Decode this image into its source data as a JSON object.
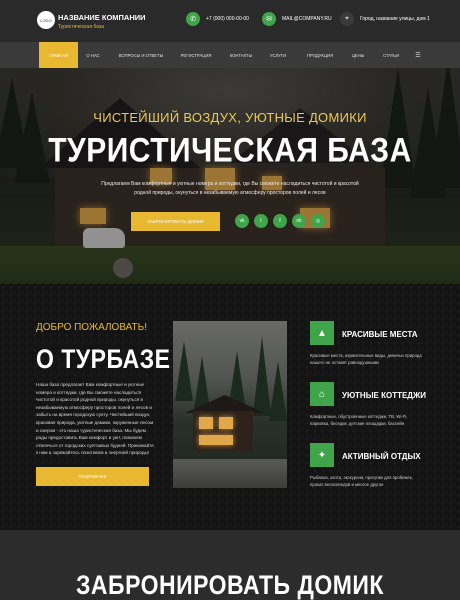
{
  "header": {
    "logo_text": "LOGO",
    "company_name": "НАЗВАНИЕ КОМПАНИИ",
    "company_sub": "Туристическая база",
    "phone": "+7 (000) 000-00-00",
    "email": "MAIL@COMPANY.RU",
    "address": "Город, название улицы, дом 1",
    "phone_icon": "phone-icon",
    "mail_icon": "mail-icon",
    "location_icon": "location-pin-icon"
  },
  "nav": {
    "items": [
      "ГЛАВНАЯ",
      "О НАС",
      "ВОПРОСЫ И ОТВЕТЫ",
      "РЕГИСТРАЦИЯ",
      "КОНТАКТЫ",
      "УСЛУГИ",
      "ПРОДУКЦИЯ",
      "ЦЕНЫ",
      "СТАТЬИ",
      "☰"
    ],
    "active": "ГЛАВНАЯ"
  },
  "hero": {
    "tagline": "ЧИСТЕЙШИЙ ВОЗДУХ, УЮТНЫЕ ДОМИКИ",
    "title": "ТУРИСТИЧЕСКАЯ БАЗА",
    "description": "Предлагаем Вам комфортные и уютные номера и коттеджи, где Вы сможете насладиться чистотой и красотой родной природы, окунуться в незабываемую атмосферу просторов полей и лесов",
    "button": "ЗАБРОНИРОВАТЬ ДОМИК",
    "social": [
      "vk-icon",
      "twitter-icon",
      "facebook-icon",
      "odnoklassniki-icon",
      "instagram-icon"
    ]
  },
  "about": {
    "welcome": "ДОБРО ПОЖАЛОВАТЬ!",
    "title": "О ТУРБАЗЕ",
    "text": "Наша база предлагает Вам комфортные и уютные номера и коттеджи, где Вы сможете насладиться чистотой и красотой родной природы, окунуться в незабываемую атмосферу просторов полей и лесов и забыть на время городскую суету. Чистейший воздух, красивая природа, уютные домики, окруженные лесом и озером - это наша туристическая база. Мы будем рады предоставить Вам комфорт и уют, поможем отвлечься от городских суетливых будней. Приезжайте к нам и заряжайтесь позитивом и энергией природы!",
    "button": "ПОДРОБНЕЕ"
  },
  "features": [
    {
      "icon": "mountains-icon",
      "title": "КРАСИВЫЕ МЕСТА",
      "desc": "Красивые места, изумительные виды, девичьи природа нашего не оставят равнодушными"
    },
    {
      "icon": "house-icon",
      "title": "УЮТНЫЕ КОТТЕДЖИ",
      "desc": "Комфортные, обустроенные коттеджи, ТВ, Wi-Fi, парковка, беседки, детские площадки, бассейн"
    },
    {
      "icon": "hiking-icon",
      "title": "АКТИВНЫЙ ОТДЫХ",
      "desc": "Рыбалка, охота, экскурсии, прогулки для пробежек, прокат велосипедов и многое другое"
    }
  ],
  "booking": {
    "title": "ЗАБРОНИРОВАТЬ ДОМИК"
  },
  "colors": {
    "accent": "#e8b830",
    "green": "#3fa44a"
  }
}
